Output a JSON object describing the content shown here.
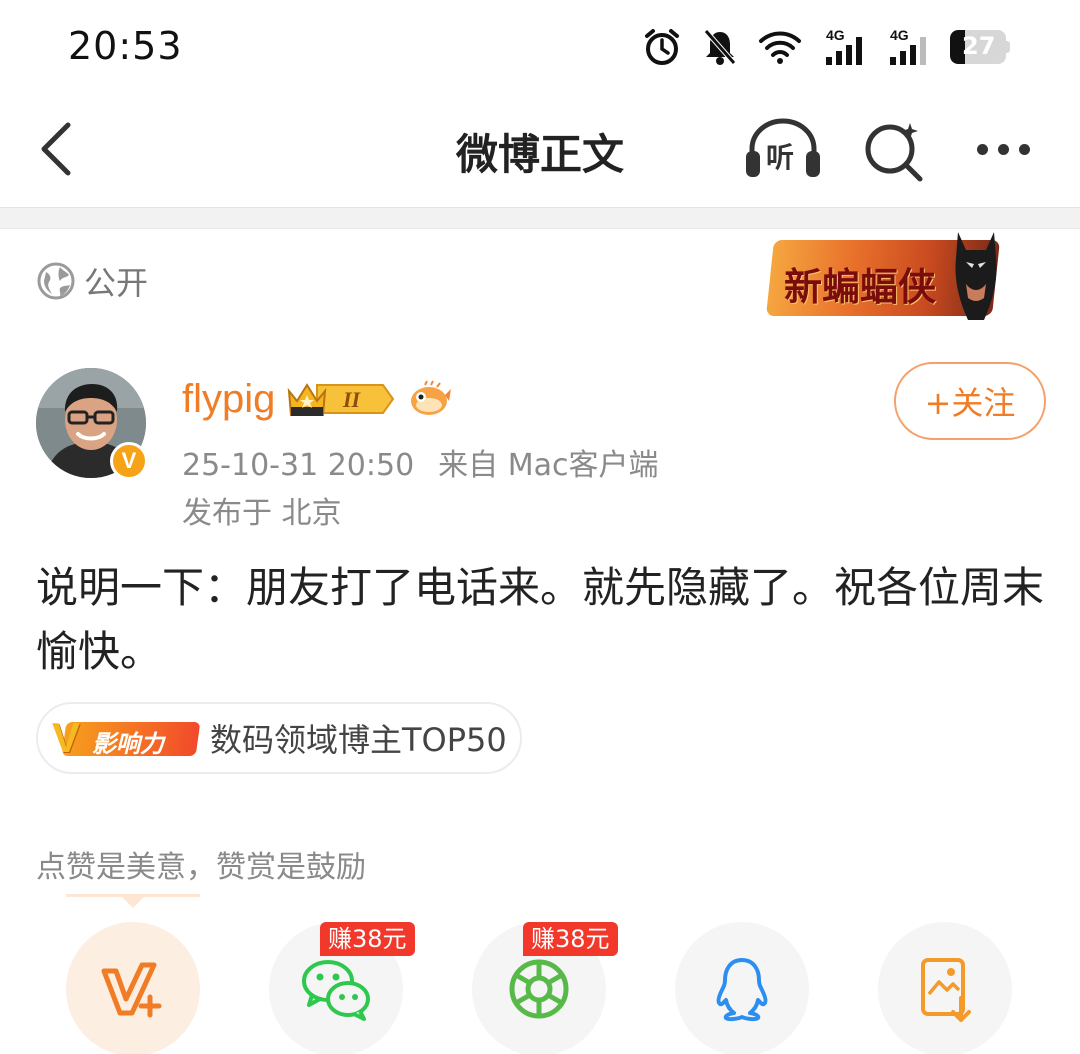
{
  "status_bar": {
    "time": "20:53",
    "network_1": "4G",
    "network_2": "4G",
    "battery": "27",
    "battery_level": 0.27
  },
  "nav": {
    "title": "微博正文",
    "listen_label": "听"
  },
  "post": {
    "visibility": "公开",
    "theme_badge_text": "新蝙蝠侠",
    "author": {
      "name": "flypig",
      "verified_mark": "V",
      "level": "II"
    },
    "meta": {
      "timestamp": "25-10-31 20:50",
      "source": "来自 Mac客户端",
      "location": "发布于 北京"
    },
    "follow_label": "+关注",
    "body": "说明一下：朋友打了电话来。就先隐藏了。祝各位周末愉快。",
    "influence": {
      "logo_v": "V",
      "logo_text": "影响力",
      "text": "数码领域博主TOP50"
    },
    "reward_caption": "点赞是美意，赞赏是鼓励"
  },
  "share": {
    "items": [
      {
        "icon": "reward-icon"
      },
      {
        "icon": "wechat-icon",
        "badge": "赚38元"
      },
      {
        "icon": "moments-icon",
        "badge": "赚38元"
      },
      {
        "icon": "qq-icon"
      },
      {
        "icon": "save-image-icon"
      }
    ]
  },
  "colors": {
    "accent_orange": "#f07c26",
    "muted_text": "#8a8a8a",
    "earn_badge": "#f2382b",
    "wechat_green": "#2dc84d"
  }
}
